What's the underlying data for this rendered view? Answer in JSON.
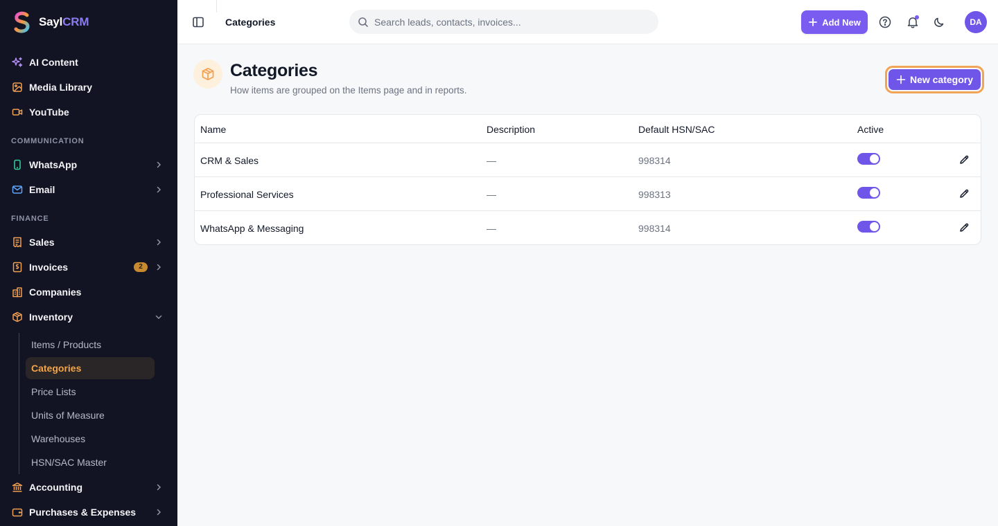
{
  "brand": {
    "name_main": "Sayl",
    "name_accent": "CRM"
  },
  "sidebar": {
    "items_top": [
      {
        "label": "AI Content",
        "icon": "sparkles-icon"
      },
      {
        "label": "Media Library",
        "icon": "image-icon"
      },
      {
        "label": "YouTube",
        "icon": "video-icon"
      }
    ],
    "section_communication": "COMMUNICATION",
    "communication": [
      {
        "label": "WhatsApp",
        "icon": "phone-icon"
      },
      {
        "label": "Email",
        "icon": "mail-icon"
      }
    ],
    "section_finance": "FINANCE",
    "finance": [
      {
        "label": "Sales",
        "icon": "receipt-icon"
      },
      {
        "label": "Invoices",
        "icon": "invoice-icon",
        "badge": "2"
      },
      {
        "label": "Companies",
        "icon": "building-icon"
      },
      {
        "label": "Inventory",
        "icon": "box-icon"
      }
    ],
    "inventory_sub": [
      {
        "label": "Items / Products"
      },
      {
        "label": "Categories",
        "active": true
      },
      {
        "label": "Price Lists"
      },
      {
        "label": "Units of Measure"
      },
      {
        "label": "Warehouses"
      },
      {
        "label": "HSN/SAC Master"
      }
    ],
    "bottom": [
      {
        "label": "Accounting",
        "icon": "bank-icon"
      },
      {
        "label": "Purchases & Expenses",
        "icon": "wallet-icon"
      }
    ]
  },
  "topbar": {
    "title": "Categories",
    "search_placeholder": "Search leads, contacts, invoices...",
    "add_new_label": "Add New",
    "avatar_initials": "DA"
  },
  "page": {
    "title": "Categories",
    "subtitle": "How items are grouped on the Items page and in reports.",
    "new_button_label": "New category"
  },
  "table": {
    "headers": {
      "name": "Name",
      "description": "Description",
      "hsn": "Default HSN/SAC",
      "active": "Active"
    },
    "rows": [
      {
        "name": "CRM & Sales",
        "description": "—",
        "hsn": "998314",
        "active": true
      },
      {
        "name": "Professional Services",
        "description": "—",
        "hsn": "998313",
        "active": true
      },
      {
        "name": "WhatsApp & Messaging",
        "description": "—",
        "hsn": "998314",
        "active": true
      }
    ]
  },
  "colors": {
    "sidebar_bg": "#121424",
    "accent_purple": "#6f55e8",
    "accent_orange": "#f5a446",
    "page_bg": "#f7f8fa"
  }
}
